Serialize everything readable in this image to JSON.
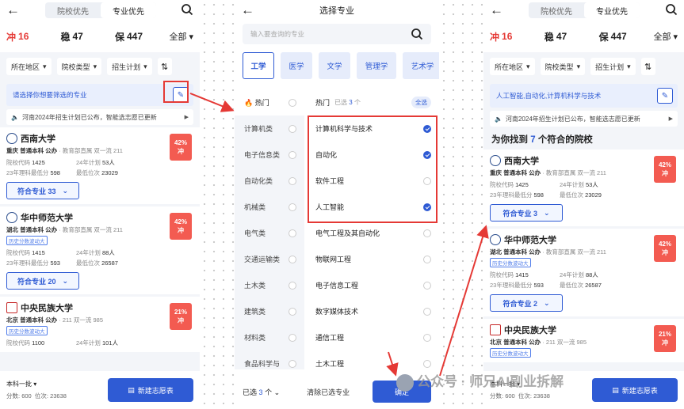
{
  "header": {
    "tab_school": "院校优先",
    "tab_major": "专业优先"
  },
  "tabs": {
    "chong": "冲",
    "chong_n": "16",
    "wen": "稳",
    "wen_n": "47",
    "bao": "保",
    "bao_n": "447",
    "all": "全部"
  },
  "filters": {
    "region": "所在地区",
    "type": "院校类型",
    "plan": "招生计划"
  },
  "hint_empty": "请选择你想要筛选的专业",
  "hint_selected": "人工智能,自动化,计算机科学与技术",
  "notice": "河南2024年招生计划已公布，智能选志愿已更新",
  "found": {
    "prefix": "为你找到",
    "count": "7",
    "suffix": "个符合的院校"
  },
  "schools": [
    {
      "name": "西南大学",
      "meta": "重庆 普通本科 公办",
      "meta2": "· 教育部直属 双一流 211",
      "code_label": "院校代码",
      "code": "1425",
      "plan_label": "24年计划",
      "plan": "53人",
      "rank_label": "23年理科最低分",
      "score": "598",
      "min_label": "最低位次",
      "min": "23029",
      "badge_pct": "42%",
      "badge": "冲",
      "match1": "符合专业 33",
      "match3": "符合专业 3"
    },
    {
      "name": "华中师范大学",
      "meta": "湖北 普通本科 公办",
      "meta2": "· 教育部直属 双一流 211",
      "tag": "历史分数波动大",
      "code_label": "院校代码",
      "code": "1415",
      "plan_label": "24年计划",
      "plan": "88人",
      "rank_label": "23年理科最低分",
      "score": "593",
      "min_label": "最低位次",
      "min": "26587",
      "badge_pct": "42%",
      "badge": "冲",
      "match1": "符合专业 20",
      "match3": "符合专业 2"
    },
    {
      "name": "中央民族大学",
      "meta": "北京 普通本科 公办",
      "meta2": "· 211 双一流 985",
      "tag": "历史分数波动大",
      "code_label": "院校代码",
      "code": "1100",
      "plan_label": "24年计划",
      "plan": "101人",
      "badge_pct": "21%",
      "badge": "冲"
    }
  ],
  "bottom": {
    "batch": "本科一批",
    "score_label": "分数:",
    "score": "600",
    "rank_label": "位次:",
    "rank": "23638",
    "new_btn": "新建志愿表"
  },
  "picker": {
    "title": "选择专业",
    "placeholder": "输入要查询的专业",
    "categories": [
      "工学",
      "医学",
      "文学",
      "管理学",
      "艺术学"
    ],
    "left": [
      "热门",
      "计算机类",
      "电子信息类",
      "自动化类",
      "机械类",
      "电气类",
      "交通运输类",
      "土木类",
      "建筑类",
      "材料类",
      "食品科学与"
    ],
    "right_head": {
      "label": "热门",
      "selected": "已选",
      "count": "3",
      "unit": "个",
      "select_all": "全选"
    },
    "majors": [
      {
        "name": "计算机科学与技术",
        "checked": true
      },
      {
        "name": "自动化",
        "checked": true
      },
      {
        "name": "软件工程",
        "checked": false
      },
      {
        "name": "人工智能",
        "checked": true
      },
      {
        "name": "电气工程及其自动化",
        "checked": false
      },
      {
        "name": "物联网工程",
        "checked": false
      },
      {
        "name": "电子信息工程",
        "checked": false
      },
      {
        "name": "数字媒体技术",
        "checked": false
      },
      {
        "name": "通信工程",
        "checked": false
      },
      {
        "name": "土木工程",
        "checked": false
      }
    ],
    "footer": {
      "selected": "已选",
      "count": "3",
      "unit": "个",
      "clear": "清除已选专业",
      "confirm": "确定"
    }
  },
  "watermark": "公众号 · 师兄AI副业拆解",
  "colors": {
    "accent": "#2f5bd4",
    "danger": "#e53935",
    "badge": "#f35b51"
  }
}
